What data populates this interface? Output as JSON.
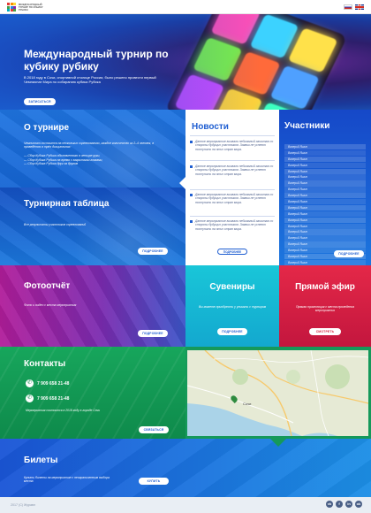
{
  "header": {
    "logo_lines": [
      "МЕЖДУНАРОДНЫЙ",
      "ТУРНИР ПО КУБИКУ",
      "РУБИКА"
    ],
    "logo_colors": [
      "#e53935",
      "#fb8c00",
      "#fdd835",
      "#43a047",
      "#1e88e5",
      "#8e24aa",
      "#00acc1",
      "#e53935",
      "#43a047"
    ],
    "languages": [
      "ru",
      "en"
    ]
  },
  "hero": {
    "title": "Международный турнир по кубику рубику",
    "text": "В 2018 году в Сочи, спортивной столице России, было решено провести первый Чемпионат Мира по собиранию кубика Рубика",
    "button": "ЗАПИСАТЬСЯ",
    "cube_colors": [
      "#ff4fb8",
      "#3cd2ff",
      "#ffe14a",
      "#7cf04a",
      "#ff6a3a",
      "#4fa0ff",
      "#c94cff",
      "#ffd23a",
      "#3cffc1"
    ]
  },
  "about": {
    "title": "О турнире",
    "text": "Чемпионат состоится на нескольких соревнованиях, каждое количество из 2–4 человек, в проведётся в трёх дисциплинах:",
    "items": [
      "— Сбор Кубика Рубика обозначенного в четыре руки,",
      "— Сбор Кубика Рубика на время с закрытыми глазами,",
      "— Сбор Кубика Рубика друг за другом"
    ]
  },
  "standings": {
    "title": "Турнирная таблица",
    "text": "Все результаты участников соревнований",
    "button": "ПОДРОБНЕЕ"
  },
  "news": {
    "title": "Новости",
    "items": [
      "Данное мероприятие вызвало небывалый ажиотаж со стороны будущих участников. Заявки не успеют поступить на этих стран мира.",
      "Данное мероприятие вызвало небывалый ажиотаж со стороны будущих участников. Заявки не успеют поступить на этих стран мира.",
      "Данное мероприятие вызвало небывалый ажиотаж со стороны будущих участников. Заявки не успеют поступить на этих стран мира.",
      "Данное мероприятие вызвало небывалый ажиотаж со стороны будущих участников. Заявки не успеют поступить на этих стран мира."
    ],
    "button": "ПОДРОБНЕЕ"
  },
  "participants": {
    "title": "Участники",
    "rows": [
      "Валерий Яшин",
      "Валерий Яшин",
      "Валерий Яшин",
      "Валерий Яшин",
      "Валерий Яшин",
      "Валерий Яшин",
      "Валерий Яшин",
      "Валерий Яшин",
      "Валерий Яшин",
      "Валерий Яшин",
      "Валерий Яшин",
      "Валерий Яшин",
      "Валерий Яшин",
      "Валерий Яшин",
      "Валерий Яшин",
      "Валерий Яшин",
      "Валерий Яшин",
      "Валерий Яшин",
      "Валерий Яшин",
      "Валерий Яшин"
    ],
    "button": "ПОДРОБНЕЕ"
  },
  "photo": {
    "title": "Фотоотчёт",
    "text": "Фото и видео с места мероприятия",
    "button": "ПОДРОБНЕЕ"
  },
  "souvenirs": {
    "title": "Сувениры",
    "text": "Вы можете приобрести у уникать с турниром",
    "button": "ПОДРОБНЕЕ"
  },
  "live": {
    "title": "Прямой эфир",
    "text": "Прямая трансляция с места проведения мероприятия",
    "button": "СМОТРЕТЬ"
  },
  "contacts": {
    "title": "Контакты",
    "phones": [
      "7 909 658 21-48",
      "7 909 658 21-48"
    ],
    "text": "Мероприятия состоится в 2018 году в городе Сочи",
    "button": "СВЯЗАТЬСЯ"
  },
  "map": {
    "city_label": "Сочи"
  },
  "tickets": {
    "title": "Билеты",
    "text": "Купить билеты на мероприятие с неограниченным выбора места",
    "button": "КУПИТЬ"
  },
  "footer": {
    "copyright": "2017 (C) Журавл",
    "socials": [
      "vk",
      "f",
      "in",
      "ok"
    ]
  }
}
